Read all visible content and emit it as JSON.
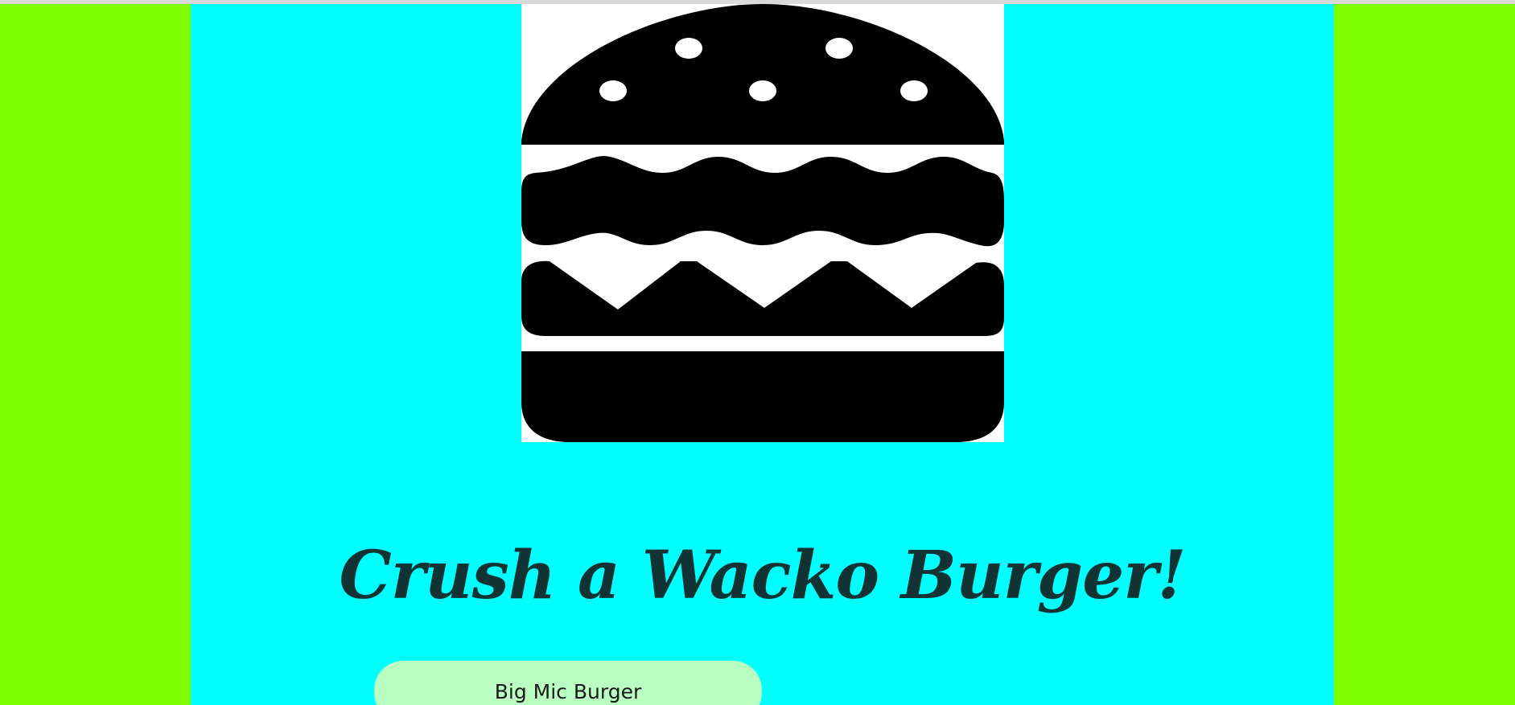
{
  "page": {
    "headline": "Crush a Wacko Burger!"
  },
  "hero_image": {
    "icon": "burger-icon"
  },
  "menu": {
    "items": [
      {
        "label": "Big Mic Burger"
      }
    ]
  },
  "colors": {
    "outer_background": "#7fff00",
    "content_background": "#00ffff",
    "image_background": "#ffffff",
    "burger_fill": "#000000",
    "menu_item_background": "#b9ffc2",
    "headline_text": "#113333"
  }
}
